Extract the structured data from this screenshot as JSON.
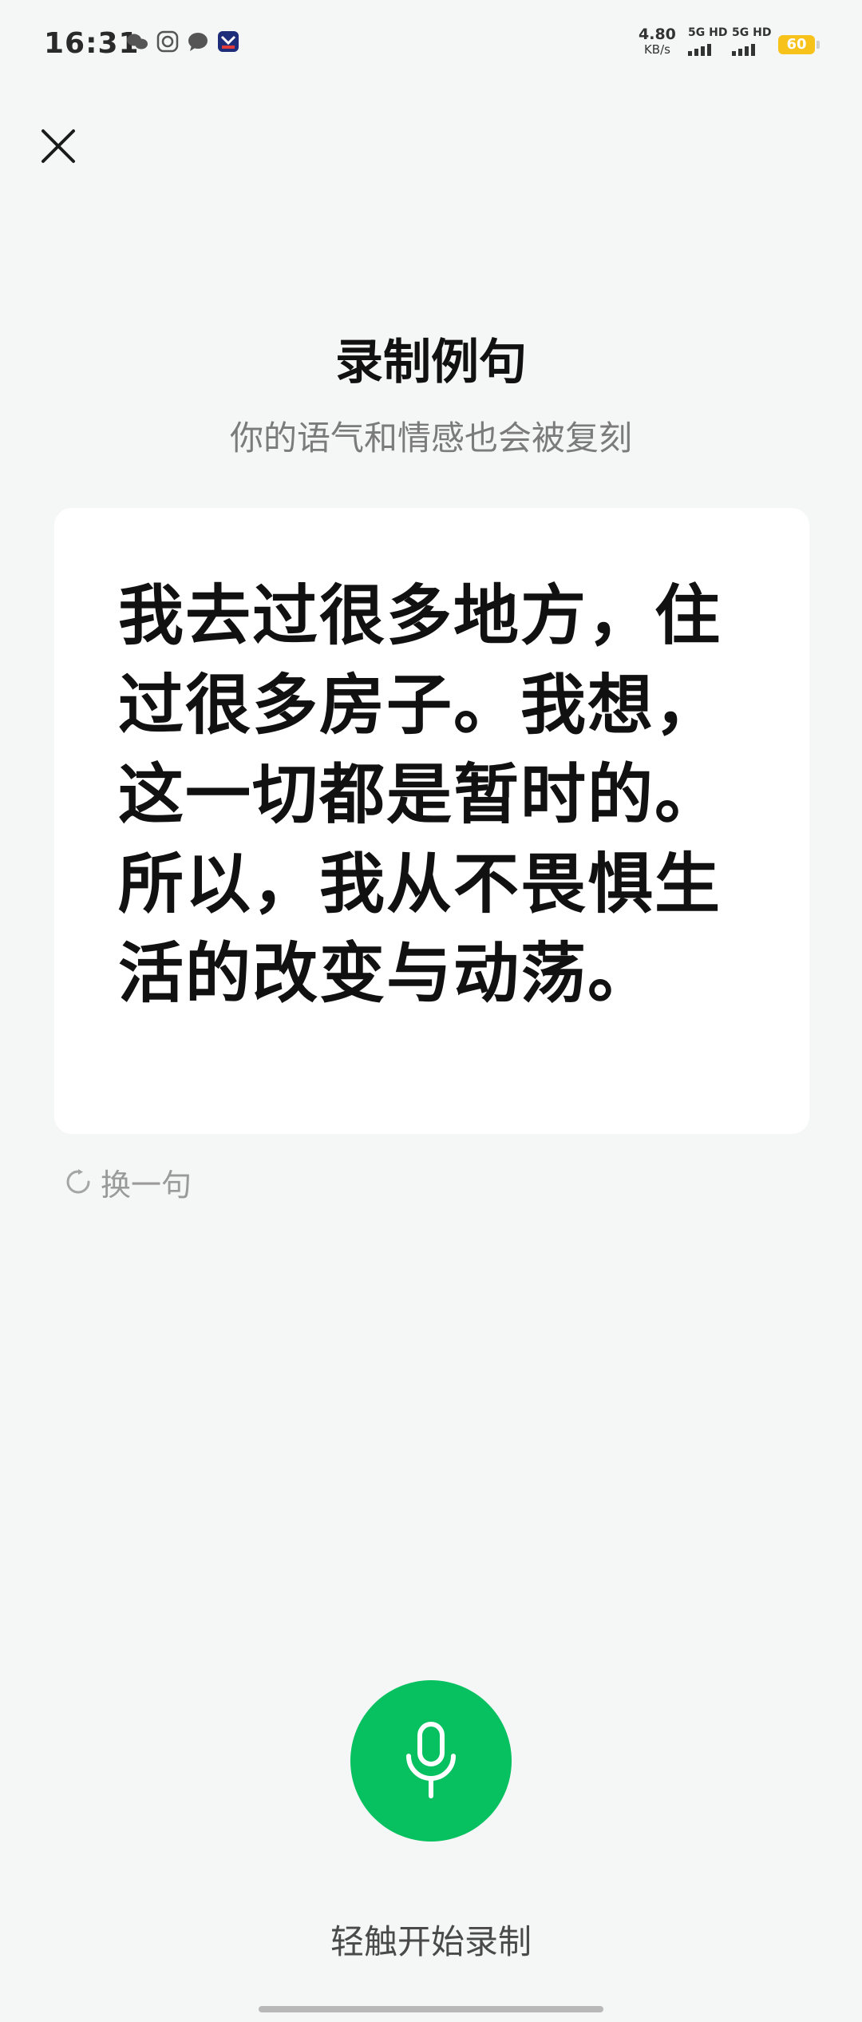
{
  "status_bar": {
    "time": "16:31",
    "net_speed_value": "4.80",
    "net_speed_unit": "KB/s",
    "signal_1_label": "5G HD",
    "signal_2_label": "5G HD",
    "battery_level": "60",
    "notification_icons": [
      "wechat-icon",
      "app-icon",
      "message-icon",
      "app-badge-icon"
    ]
  },
  "header": {
    "close_icon": "close-icon",
    "title": "录制例句",
    "subtitle": "你的语气和情感也会被复刻"
  },
  "card": {
    "sentence": "我去过很多地方，住过很多房子。我想，这一切都是暂时的。所以，我从不畏惧生活的改变与动荡。"
  },
  "change_sentence": {
    "icon": "refresh-icon",
    "label": "换一句"
  },
  "record": {
    "icon": "microphone-icon",
    "button_color": "#07c160",
    "hint": "轻触开始录制"
  }
}
